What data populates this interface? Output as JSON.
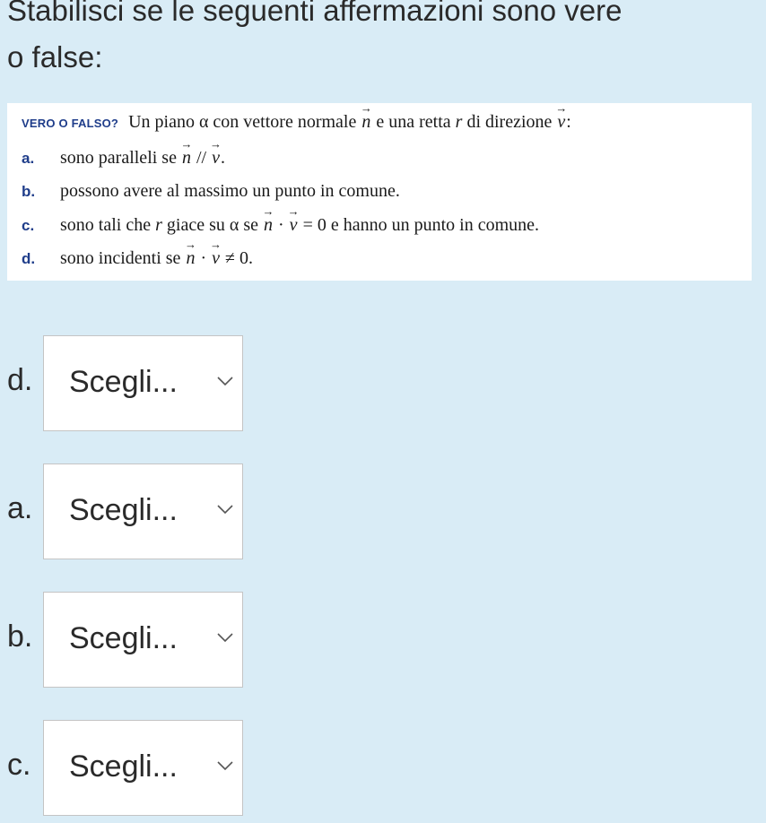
{
  "question": {
    "line1": "Stabilisci se le seguenti affermazioni sono vere",
    "line2": "o false:"
  },
  "problem": {
    "tag": "VERO O FALSO?",
    "intro_before_n": "Un piano α con vettore normale",
    "vec_n": "n",
    "intro_mid": "e una retta",
    "r": "r",
    "intro_after_r": "di direzione",
    "vec_v": "v",
    "intro_end": ":",
    "items": [
      {
        "letter": "a.",
        "text_before": "sono paralleli se",
        "math": "// ",
        "text_after": "."
      },
      {
        "letter": "b.",
        "text": "possono avere al massimo un punto in comune."
      },
      {
        "letter": "c.",
        "text_before": "sono tali che",
        "r": "r",
        "text_mid": "giace su α se",
        "op": "·",
        "eq": "= 0",
        "text_after": "e hanno un punto in comune."
      },
      {
        "letter": "d.",
        "text_before": "sono incidenti se",
        "op": "·",
        "neq": "≠ 0."
      }
    ]
  },
  "answers": [
    {
      "label": "d.",
      "select": "Scegli..."
    },
    {
      "label": "a.",
      "select": "Scegli..."
    },
    {
      "label": "b.",
      "select": "Scegli..."
    },
    {
      "label": "c.",
      "select": "Scegli..."
    }
  ],
  "icons": {
    "dropdown": "chevron-down-icon"
  }
}
